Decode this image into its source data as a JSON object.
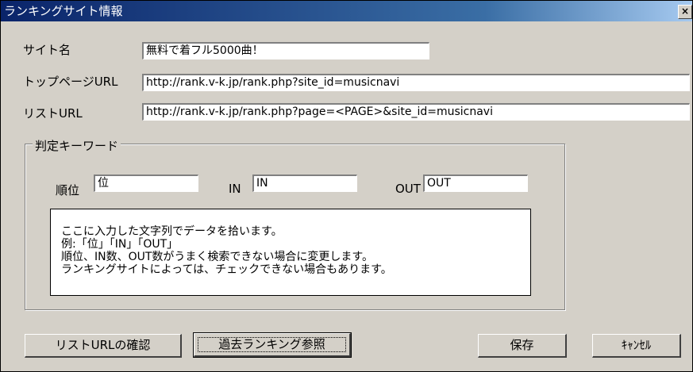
{
  "window": {
    "title": "ランキングサイト情報",
    "close_glyph": "×"
  },
  "fields": {
    "site_name": {
      "label": "サイト名",
      "value": "無料で着フル5000曲！"
    },
    "top_url": {
      "label": "トップページURL",
      "value": "http://rank.v-k.jp/rank.php?site_id=musicnavi"
    },
    "list_url": {
      "label": "リストURL",
      "value": "http://rank.v-k.jp/rank.php?page=<PAGE>&site_id=musicnavi"
    }
  },
  "keywords": {
    "group_label": "判定キーワード",
    "rank": {
      "label": "順位",
      "value": "位"
    },
    "in": {
      "label": "IN",
      "value": "IN"
    },
    "out": {
      "label": "OUT",
      "value": "OUT"
    }
  },
  "info_lines": [
    "ここに入力した文字列でデータを拾います。",
    "例:「位」「IN」「OUT」",
    "順位、IN数、OUT数がうまく検索できない場合に変更します。",
    "ランキングサイトによっては、チェックできない場合もあります。"
  ],
  "buttons": {
    "check_list_url": "リストURLの確認",
    "past_ranking": "過去ランキング参照",
    "save": "保存",
    "cancel": "ｷｬﾝｾﾙ"
  }
}
